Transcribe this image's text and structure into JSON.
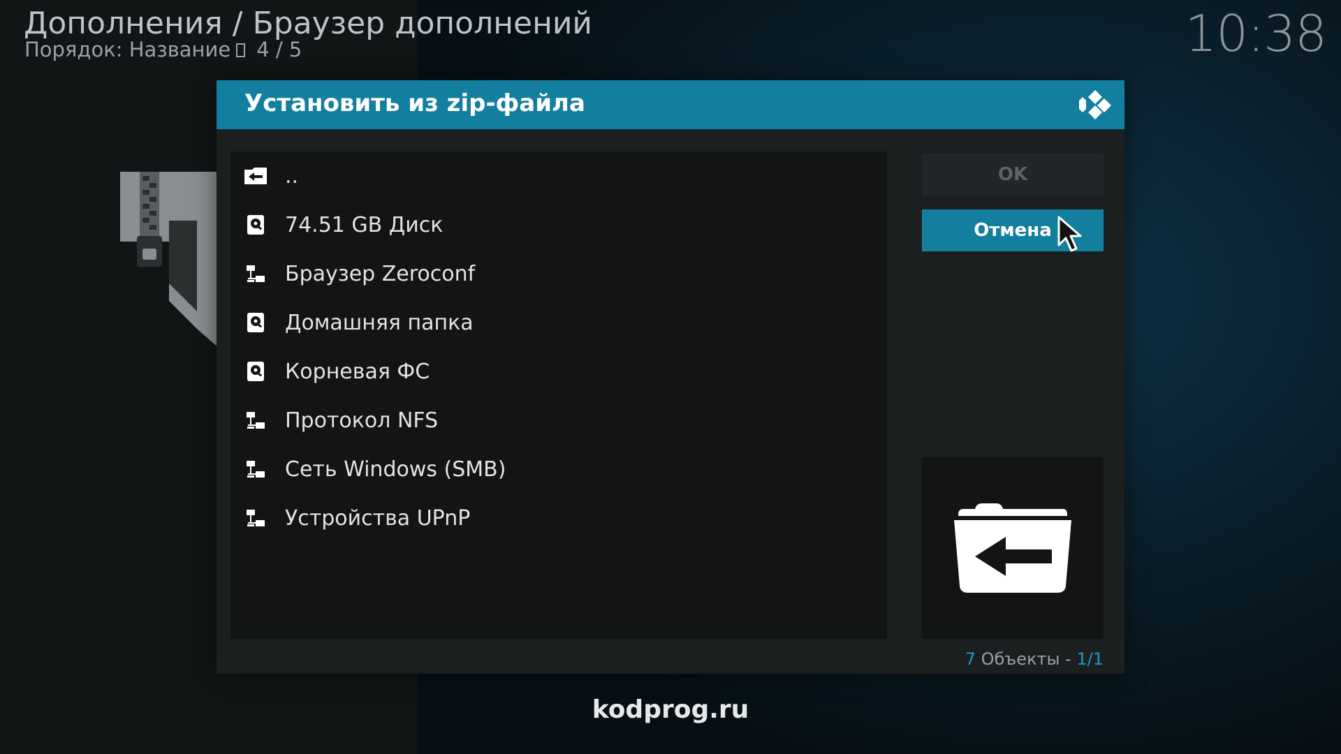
{
  "header": {
    "breadcrumb": "Дополнения / Браузер дополнений",
    "sort_label": "Порядок: Название",
    "page_counter": "4 / 5",
    "clock": "10:38"
  },
  "dialog": {
    "title": "Установить из zip-файла",
    "items": [
      {
        "label": "..",
        "icon": "folder-back-icon"
      },
      {
        "label": "74.51 GB Диск",
        "icon": "hard-drive-icon"
      },
      {
        "label": "Браузер Zeroconf",
        "icon": "network-icon"
      },
      {
        "label": "Домашняя папка",
        "icon": "hard-drive-icon"
      },
      {
        "label": "Корневая ФС",
        "icon": "hard-drive-icon"
      },
      {
        "label": "Протокол NFS",
        "icon": "network-icon"
      },
      {
        "label": "Сеть Windows (SMB)",
        "icon": "network-icon"
      },
      {
        "label": "Устройства UPnP",
        "icon": "network-icon"
      }
    ],
    "ok_label": "OK",
    "cancel_label": "Отмена",
    "count_number": "7",
    "count_text": " Объекты - ",
    "count_pages": "1/1"
  },
  "watermark": "kodprog.ru",
  "colors": {
    "accent": "#127f9f",
    "dialog_bg": "#1c1f20",
    "list_bg": "#121415",
    "highlight_text": "#1b9cc4"
  }
}
